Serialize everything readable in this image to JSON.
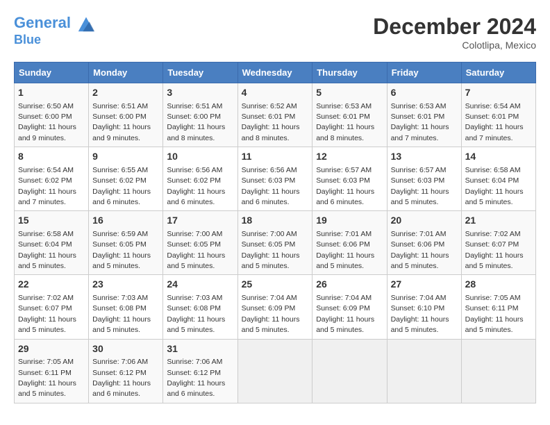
{
  "header": {
    "logo_line1": "General",
    "logo_line2": "Blue",
    "month": "December 2024",
    "location": "Colotlipa, Mexico"
  },
  "weekdays": [
    "Sunday",
    "Monday",
    "Tuesday",
    "Wednesday",
    "Thursday",
    "Friday",
    "Saturday"
  ],
  "weeks": [
    [
      {
        "day": "1",
        "sunrise": "6:50 AM",
        "sunset": "6:00 PM",
        "daylight": "11 hours and 9 minutes."
      },
      {
        "day": "2",
        "sunrise": "6:51 AM",
        "sunset": "6:00 PM",
        "daylight": "11 hours and 9 minutes."
      },
      {
        "day": "3",
        "sunrise": "6:51 AM",
        "sunset": "6:00 PM",
        "daylight": "11 hours and 8 minutes."
      },
      {
        "day": "4",
        "sunrise": "6:52 AM",
        "sunset": "6:01 PM",
        "daylight": "11 hours and 8 minutes."
      },
      {
        "day": "5",
        "sunrise": "6:53 AM",
        "sunset": "6:01 PM",
        "daylight": "11 hours and 8 minutes."
      },
      {
        "day": "6",
        "sunrise": "6:53 AM",
        "sunset": "6:01 PM",
        "daylight": "11 hours and 7 minutes."
      },
      {
        "day": "7",
        "sunrise": "6:54 AM",
        "sunset": "6:01 PM",
        "daylight": "11 hours and 7 minutes."
      }
    ],
    [
      {
        "day": "8",
        "sunrise": "6:54 AM",
        "sunset": "6:02 PM",
        "daylight": "11 hours and 7 minutes."
      },
      {
        "day": "9",
        "sunrise": "6:55 AM",
        "sunset": "6:02 PM",
        "daylight": "11 hours and 6 minutes."
      },
      {
        "day": "10",
        "sunrise": "6:56 AM",
        "sunset": "6:02 PM",
        "daylight": "11 hours and 6 minutes."
      },
      {
        "day": "11",
        "sunrise": "6:56 AM",
        "sunset": "6:03 PM",
        "daylight": "11 hours and 6 minutes."
      },
      {
        "day": "12",
        "sunrise": "6:57 AM",
        "sunset": "6:03 PM",
        "daylight": "11 hours and 6 minutes."
      },
      {
        "day": "13",
        "sunrise": "6:57 AM",
        "sunset": "6:03 PM",
        "daylight": "11 hours and 5 minutes."
      },
      {
        "day": "14",
        "sunrise": "6:58 AM",
        "sunset": "6:04 PM",
        "daylight": "11 hours and 5 minutes."
      }
    ],
    [
      {
        "day": "15",
        "sunrise": "6:58 AM",
        "sunset": "6:04 PM",
        "daylight": "11 hours and 5 minutes."
      },
      {
        "day": "16",
        "sunrise": "6:59 AM",
        "sunset": "6:05 PM",
        "daylight": "11 hours and 5 minutes."
      },
      {
        "day": "17",
        "sunrise": "7:00 AM",
        "sunset": "6:05 PM",
        "daylight": "11 hours and 5 minutes."
      },
      {
        "day": "18",
        "sunrise": "7:00 AM",
        "sunset": "6:05 PM",
        "daylight": "11 hours and 5 minutes."
      },
      {
        "day": "19",
        "sunrise": "7:01 AM",
        "sunset": "6:06 PM",
        "daylight": "11 hours and 5 minutes."
      },
      {
        "day": "20",
        "sunrise": "7:01 AM",
        "sunset": "6:06 PM",
        "daylight": "11 hours and 5 minutes."
      },
      {
        "day": "21",
        "sunrise": "7:02 AM",
        "sunset": "6:07 PM",
        "daylight": "11 hours and 5 minutes."
      }
    ],
    [
      {
        "day": "22",
        "sunrise": "7:02 AM",
        "sunset": "6:07 PM",
        "daylight": "11 hours and 5 minutes."
      },
      {
        "day": "23",
        "sunrise": "7:03 AM",
        "sunset": "6:08 PM",
        "daylight": "11 hours and 5 minutes."
      },
      {
        "day": "24",
        "sunrise": "7:03 AM",
        "sunset": "6:08 PM",
        "daylight": "11 hours and 5 minutes."
      },
      {
        "day": "25",
        "sunrise": "7:04 AM",
        "sunset": "6:09 PM",
        "daylight": "11 hours and 5 minutes."
      },
      {
        "day": "26",
        "sunrise": "7:04 AM",
        "sunset": "6:09 PM",
        "daylight": "11 hours and 5 minutes."
      },
      {
        "day": "27",
        "sunrise": "7:04 AM",
        "sunset": "6:10 PM",
        "daylight": "11 hours and 5 minutes."
      },
      {
        "day": "28",
        "sunrise": "7:05 AM",
        "sunset": "6:11 PM",
        "daylight": "11 hours and 5 minutes."
      }
    ],
    [
      {
        "day": "29",
        "sunrise": "7:05 AM",
        "sunset": "6:11 PM",
        "daylight": "11 hours and 5 minutes."
      },
      {
        "day": "30",
        "sunrise": "7:06 AM",
        "sunset": "6:12 PM",
        "daylight": "11 hours and 6 minutes."
      },
      {
        "day": "31",
        "sunrise": "7:06 AM",
        "sunset": "6:12 PM",
        "daylight": "11 hours and 6 minutes."
      },
      null,
      null,
      null,
      null
    ]
  ]
}
